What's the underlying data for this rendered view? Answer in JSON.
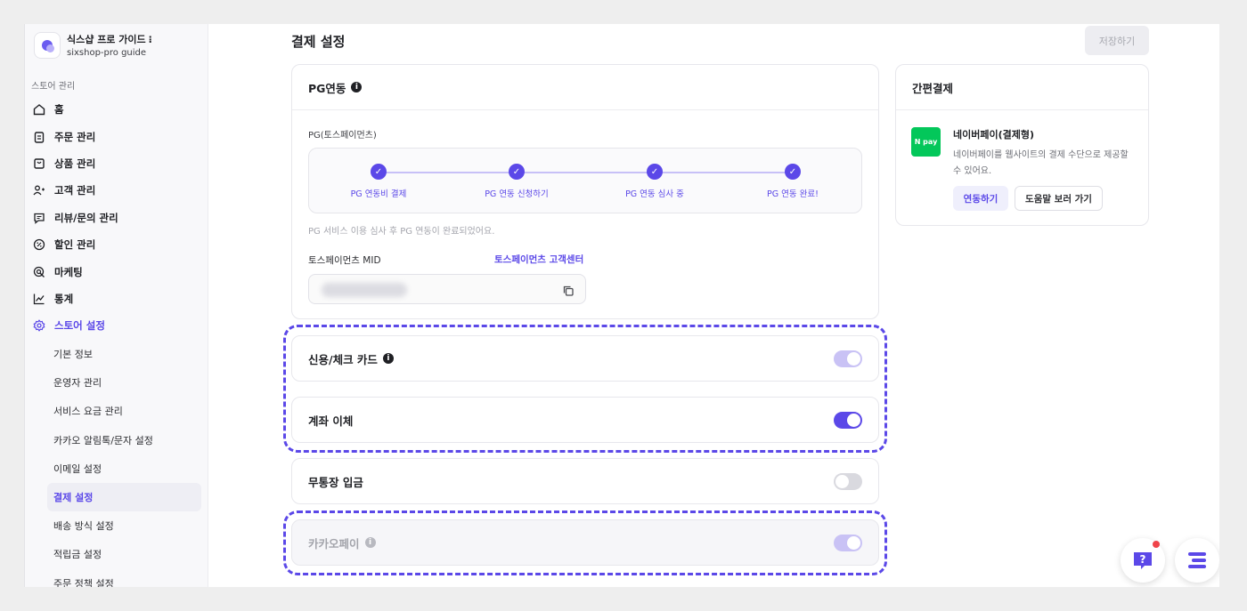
{
  "brand": {
    "name": "식스샵 프로 가이드",
    "kebab": "⁝",
    "subtitle": "sixshop-pro guide"
  },
  "sidebar": {
    "section_label": "스토어 관리",
    "items": [
      {
        "label": "홈",
        "icon": "home-icon"
      },
      {
        "label": "주문 관리",
        "icon": "clipboard-icon"
      },
      {
        "label": "상품 관리",
        "icon": "bag-icon"
      },
      {
        "label": "고객 관리",
        "icon": "users-icon"
      },
      {
        "label": "리뷰/문의 관리",
        "icon": "chat-icon"
      },
      {
        "label": "할인 관리",
        "icon": "discount-icon"
      },
      {
        "label": "마케팅",
        "icon": "target-icon"
      },
      {
        "label": "통계",
        "icon": "chart-icon"
      },
      {
        "label": "스토어 설정",
        "icon": "gear-icon"
      }
    ],
    "sub_items": [
      "기본 정보",
      "운영자 관리",
      "서비스 요금 관리",
      "카카오 알림톡/문자 설정",
      "이메일 설정",
      "결제 설정",
      "배송 방식 설정",
      "적립금 설정",
      "주문 정책 설정"
    ],
    "active_sub": "결제 설정"
  },
  "main": {
    "title": "결제 설정",
    "save_label": "저장하기",
    "pg": {
      "title": "PG연동",
      "info": "i",
      "provider": "PG(토스페이먼츠)",
      "steps": [
        "PG 연동비 결제",
        "PG 연동 신청하기",
        "PG 연동 심사 중",
        "PG 연동 완료!"
      ],
      "check": "✓",
      "note": "PG 서비스 이용 심사 후 PG 연동이 완료되었어요.",
      "mid_label": "토스페이먼츠 MID",
      "support_link": "토스페이먼츠 고객센터"
    },
    "methods": [
      {
        "label": "신용/체크 카드",
        "has_info": true,
        "enabled": true
      },
      {
        "label": "계좌 이체",
        "has_info": false,
        "enabled": true
      },
      {
        "label": "무통장 입금",
        "has_info": false,
        "enabled": false
      },
      {
        "label": "카카오페이",
        "has_info": true,
        "enabled": true
      }
    ]
  },
  "easy_pay": {
    "title": "간편결제",
    "logo_text": "N pay",
    "name": "네이버페이(결제형)",
    "description": "네이버페이를 웹사이트의 결제 수단으로 제공할 수 있어요.",
    "connect_label": "연동하기",
    "help_label": "도움말 보러 가기"
  },
  "fab": {
    "help_glyph": "?"
  },
  "colors": {
    "accent": "#5b48e8",
    "naver_green": "#03c75a",
    "notification": "#f0444a"
  }
}
